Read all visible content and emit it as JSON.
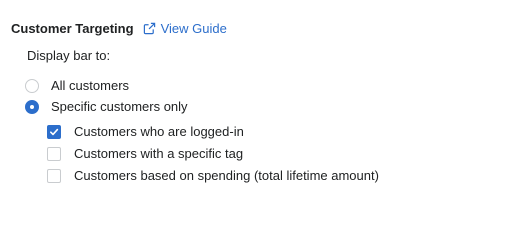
{
  "section": {
    "title": "Customer Targeting",
    "guide_link": "View Guide"
  },
  "display": {
    "label": "Display bar to:"
  },
  "radios": [
    {
      "label": "All customers",
      "selected": false
    },
    {
      "label": "Specific customers only",
      "selected": true
    }
  ],
  "checkboxes": [
    {
      "label": "Customers who are logged-in",
      "checked": true
    },
    {
      "label": "Customers with a specific tag",
      "checked": false
    },
    {
      "label": "Customers based on spending (total lifetime amount)",
      "checked": false
    }
  ],
  "colors": {
    "accent": "#2c6ecb",
    "text": "#202223",
    "border": "#c9cccf"
  },
  "icons": {
    "guide": "external-link-icon",
    "checked": "checkmark-icon"
  }
}
